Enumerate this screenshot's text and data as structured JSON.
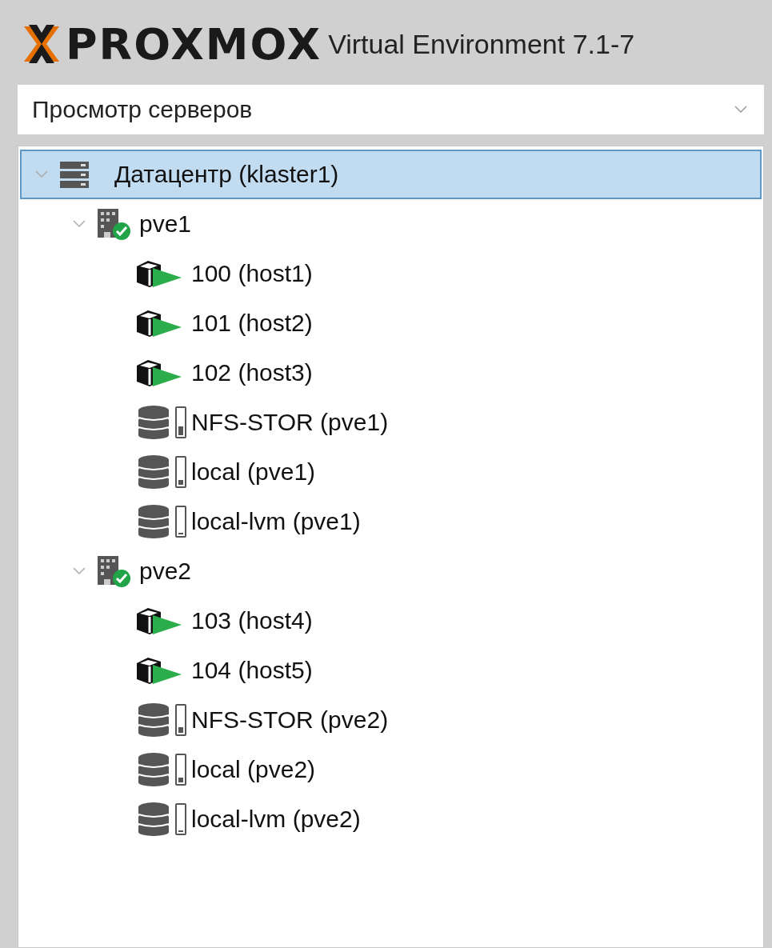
{
  "header": {
    "logo": "PROXMOX",
    "product": "Virtual Environment 7.1-7"
  },
  "view_selector": {
    "value": "Просмотр серверов"
  },
  "tree": [
    {
      "kind": "datacenter",
      "label": "Датацентр (klaster1)",
      "selected": true,
      "expanded": true,
      "children": [
        {
          "kind": "node",
          "label": "pve1",
          "selected": false,
          "expanded": true,
          "online": true,
          "children": [
            {
              "kind": "vm",
              "label": "100 (host1)",
              "selected": false,
              "running": true
            },
            {
              "kind": "vm",
              "label": "101 (host2)",
              "selected": false,
              "running": true
            },
            {
              "kind": "vm",
              "label": "102 (host3)",
              "selected": false,
              "running": true
            },
            {
              "kind": "storage",
              "label": "NFS-STOR (pve1)",
              "selected": false,
              "level": 0.35
            },
            {
              "kind": "storage",
              "label": "local (pve1)",
              "selected": false,
              "level": 0.2
            },
            {
              "kind": "storage",
              "label": "local-lvm (pve1)",
              "selected": false,
              "level": 0.06
            }
          ]
        },
        {
          "kind": "node",
          "label": "pve2",
          "selected": false,
          "expanded": true,
          "online": true,
          "children": [
            {
              "kind": "vm",
              "label": "103 (host4)",
              "selected": false,
              "running": true
            },
            {
              "kind": "vm",
              "label": "104 (host5)",
              "selected": false,
              "running": true
            },
            {
              "kind": "storage",
              "label": "NFS-STOR (pve2)",
              "selected": false,
              "level": 0.22
            },
            {
              "kind": "storage",
              "label": "local (pve2)",
              "selected": false,
              "level": 0.18
            },
            {
              "kind": "storage",
              "label": "local-lvm (pve2)",
              "selected": false,
              "level": 0.06
            }
          ]
        }
      ]
    }
  ]
}
